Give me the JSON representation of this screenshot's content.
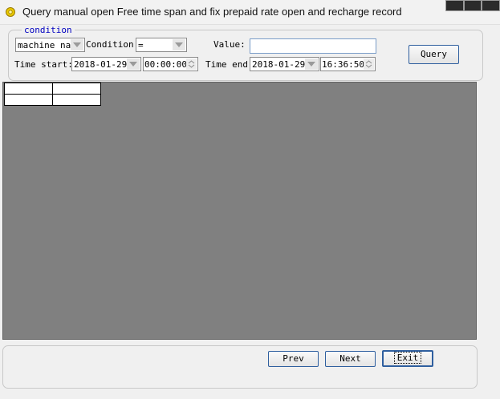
{
  "window": {
    "title": "Query manual open Free time span and fix prepaid rate open and recharge record",
    "icon": "gear-icon"
  },
  "condition_group": {
    "legend": "condition",
    "field_select": {
      "value": "machine nam"
    },
    "condition_label": "Condition:",
    "condition_select": {
      "value": "="
    },
    "value_label": "Value:",
    "value_input": {
      "value": "",
      "placeholder": ""
    },
    "query_button": "Query",
    "time_start_label": "Time start:",
    "time_start_date": "2018-01-29",
    "time_start_time": "00:00:00",
    "time_end_label": "Time end:",
    "time_end_date": "2018-01-29",
    "time_end_time": "16:36:50"
  },
  "grid": {
    "columns": [
      "",
      ""
    ],
    "rows": [
      [
        "",
        ""
      ]
    ],
    "background": "#808080"
  },
  "footer": {
    "prev_label": "Prev",
    "next_label": "Next",
    "exit_label": "Exit"
  },
  "colors": {
    "legend": "#0000c0",
    "button_border": "#2f5f9f",
    "grid_bg": "#808080"
  }
}
